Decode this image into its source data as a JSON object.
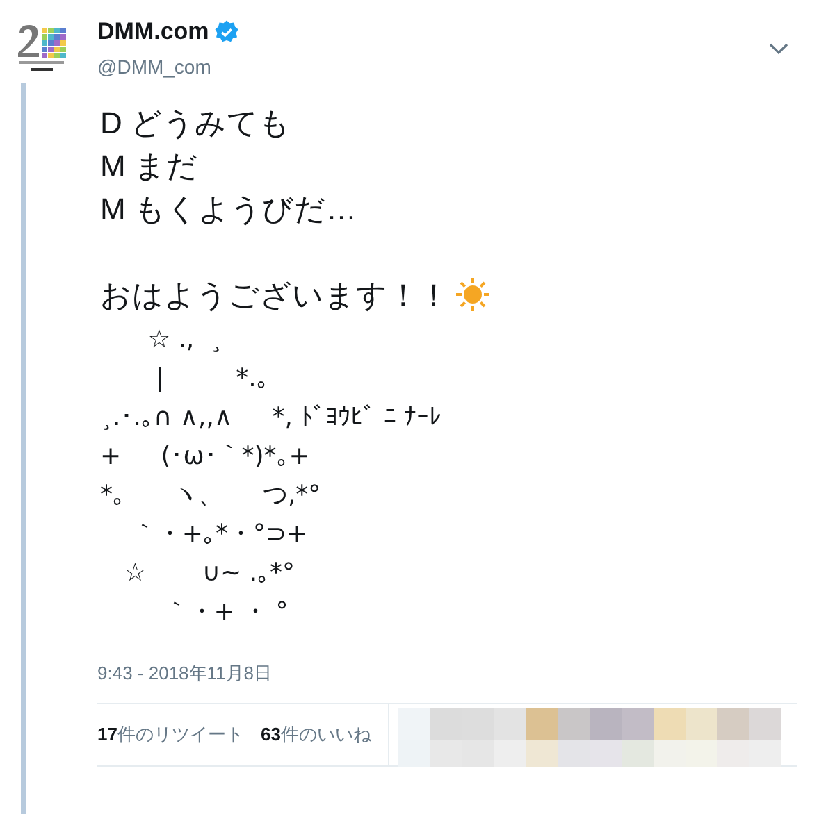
{
  "author": {
    "name": "DMM.com",
    "verified": true,
    "handle": "@DMM_com"
  },
  "tweet": {
    "paragraphs": [
      [
        "D どうみても",
        "M まだ",
        "M もくようびだ…"
      ],
      [
        "おはようございます！！"
      ]
    ],
    "art": [
      "      ☆ .,  ¸",
      "       |         *.｡",
      "¸.･.｡∩ ∧,,∧     *, ﾄﾞﾖｳﾋﾞ ﾆ ﾅｰﾚ",
      "+     (･ω･｀*)*｡+",
      "*｡      ヽ、     つ,*°",
      "    ｀・+｡*・°⊃+",
      "   ☆       ∪~ .｡*°",
      "        ｀・+ ・ °"
    ]
  },
  "timestamp": "9:43 - 2018年11月8日",
  "stats": [
    "**17**件のリツイート",
    "**63**件のいいね"
  ]
}
